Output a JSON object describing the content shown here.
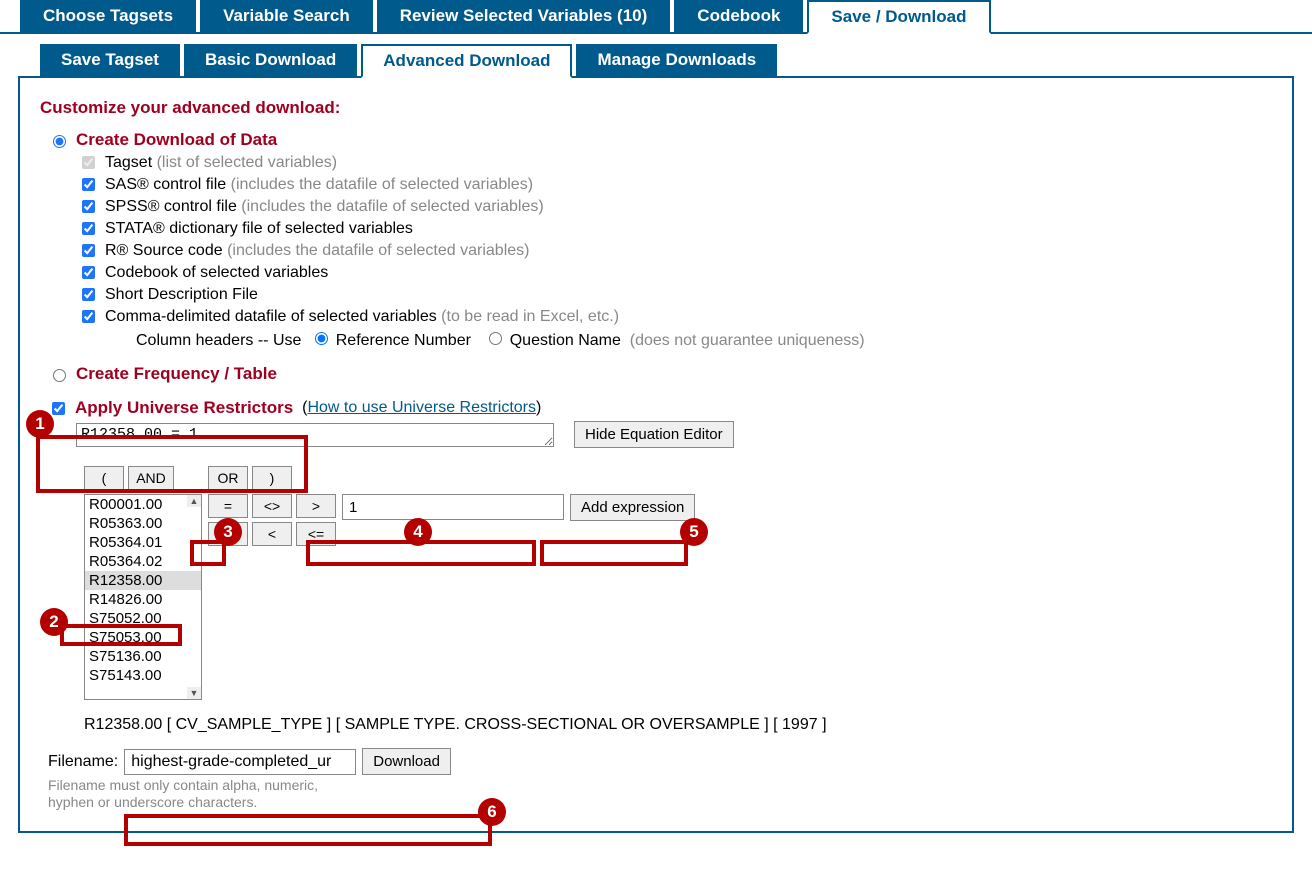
{
  "topnav": {
    "tabs": [
      {
        "label": "Choose Tagsets"
      },
      {
        "label": "Variable Search"
      },
      {
        "label": "Review Selected Variables (10)"
      },
      {
        "label": "Codebook"
      },
      {
        "label": "Save / Download",
        "active": true
      }
    ]
  },
  "subnav": {
    "tabs": [
      {
        "label": "Save Tagset"
      },
      {
        "label": "Basic Download"
      },
      {
        "label": "Advanced Download",
        "active": true
      },
      {
        "label": "Manage Downloads"
      }
    ]
  },
  "section_title": "Customize your advanced download:",
  "dl_type": {
    "create_data": "Create Download of Data",
    "create_freq": "Create Frequency / Table"
  },
  "opts": {
    "tagset_label": "Tagset",
    "tagset_hint": "(list of selected variables)",
    "sas_label": "SAS® control file",
    "sas_hint": "(includes the datafile of selected variables)",
    "spss_label": "SPSS® control file",
    "spss_hint": "(includes the datafile of selected variables)",
    "stata_label": "STATA® dictionary file of selected variables",
    "r_label": "R® Source code",
    "r_hint": "(includes the datafile of selected variables)",
    "codebook_label": "Codebook of selected variables",
    "shortdesc_label": "Short Description File",
    "csv_label": "Comma-delimited datafile of selected variables",
    "csv_hint": "(to be read in Excel, etc.)",
    "colhdr_prefix": "Column headers -- Use",
    "colhdr_ref": "Reference Number",
    "colhdr_qname": "Question Name",
    "colhdr_qname_hint": "(does not guarantee uniqueness)"
  },
  "universe": {
    "label": "Apply Universe Restrictors",
    "howto": "How to use Universe Restrictors",
    "expression": "R12358.00 = 1",
    "hide_button": "Hide Equation Editor"
  },
  "eq": {
    "ops": {
      "lparen": "(",
      "and": "AND",
      "or": "OR",
      "rparen": ")",
      "eq": "=",
      "ne": "<>",
      "gt": ">",
      "ge": ">=",
      "lt": "<",
      "le": "<="
    },
    "value": "1",
    "add_btn": "Add expression",
    "vars": [
      "R00001.00",
      "R05363.00",
      "R05364.01",
      "R05364.02",
      "R12358.00",
      "R14826.00",
      "S75052.00",
      "S75053.00",
      "S75136.00",
      "S75143.00"
    ],
    "selected_var": "R12358.00"
  },
  "var_detail": "R12358.00 [ CV_SAMPLE_TYPE ] [ SAMPLE TYPE. CROSS-SECTIONAL OR OVERSAMPLE ] [ 1997 ]",
  "filename": {
    "label": "Filename:",
    "value": "highest-grade-completed_ur",
    "button": "Download",
    "hint1": "Filename must only contain alpha, numeric,",
    "hint2": "hyphen or underscore characters."
  },
  "callouts": [
    "1",
    "2",
    "3",
    "4",
    "5",
    "6"
  ]
}
